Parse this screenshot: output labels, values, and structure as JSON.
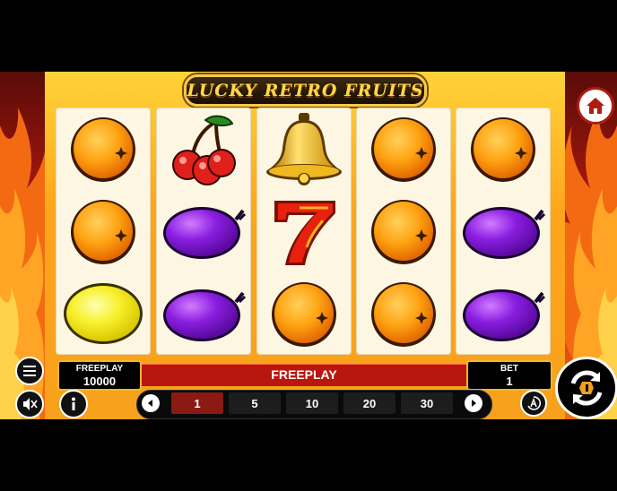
{
  "game": {
    "title": "LUCKY RETRO FRUITS"
  },
  "reels": [
    [
      "orange",
      "orange",
      "lemon"
    ],
    [
      "cherry",
      "plum",
      "plum"
    ],
    [
      "bell",
      "seven",
      "orange"
    ],
    [
      "orange",
      "orange",
      "orange"
    ],
    [
      "orange",
      "plum",
      "plum"
    ]
  ],
  "balance": {
    "label": "FREEPLAY",
    "value": "10000"
  },
  "status": {
    "message": "FREEPLAY"
  },
  "bet": {
    "label": "BET",
    "value": "1"
  },
  "bet_options": [
    "1",
    "5",
    "10",
    "20",
    "30"
  ],
  "bet_selected": "1",
  "colors": {
    "accent": "#f2b62a",
    "bar": "#b8160f",
    "reel_bg": "#fdf6e3"
  },
  "icons": {
    "home": "home-icon",
    "menu": "menu-icon",
    "sound": "sound-muted-icon",
    "info": "info-icon",
    "autoplay": "autoplay-icon",
    "spin": "spin-icon",
    "prev": "arrow-left-icon",
    "next": "arrow-right-icon"
  }
}
